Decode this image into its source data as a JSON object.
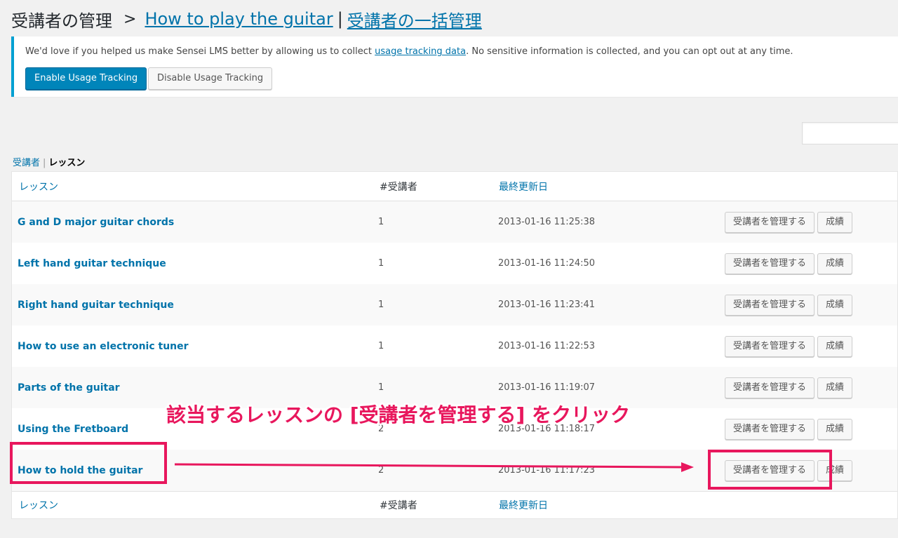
{
  "header": {
    "title": "受講者の管理",
    "separator": ">",
    "course_link": "How to play the guitar",
    "bar": "|",
    "bulk_link": "受講者の一括管理"
  },
  "notice": {
    "text_before": "We'd love if you helped us make Sensei LMS better by allowing us to collect ",
    "link": "usage tracking data",
    "text_after": ". No sensitive information is collected, and you can opt out at any time.",
    "enable_label": "Enable Usage Tracking",
    "disable_label": "Disable Usage Tracking"
  },
  "search": {
    "value": ""
  },
  "subnav": {
    "learners": "受講者",
    "pipe": "|",
    "lessons": "レッスン"
  },
  "table": {
    "columns": {
      "lesson": "レッスン",
      "count": "#受講者",
      "updated": "最終更新日"
    },
    "rows": [
      {
        "title": "G and D major guitar chords",
        "count": "1",
        "date": "2013-01-16 11:25:38"
      },
      {
        "title": "Left hand guitar technique",
        "count": "1",
        "date": "2013-01-16 11:24:50"
      },
      {
        "title": "Right hand guitar technique",
        "count": "1",
        "date": "2013-01-16 11:23:41"
      },
      {
        "title": "How to use an electronic tuner",
        "count": "1",
        "date": "2013-01-16 11:22:53"
      },
      {
        "title": "Parts of the guitar",
        "count": "1",
        "date": "2013-01-16 11:19:07"
      },
      {
        "title": "Using the Fretboard",
        "count": "2",
        "date": "2013-01-16 11:18:17"
      },
      {
        "title": "How to hold the guitar",
        "count": "2",
        "date": "2013-01-16 11:17:23"
      }
    ],
    "manage_label": "受講者を管理する",
    "grades_label": "成績"
  },
  "annotation": {
    "text": "該当するレッスンの [受講者を管理する] をクリック",
    "color": "#e8175d"
  }
}
